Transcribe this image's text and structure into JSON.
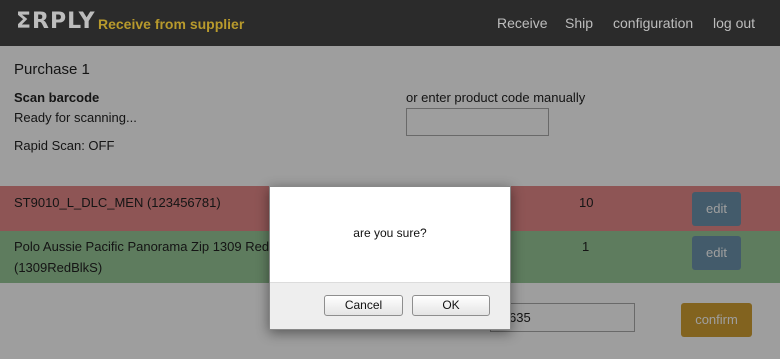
{
  "header": {
    "logo": "ΣRPLY",
    "subtitle": "Receive from supplier",
    "nav": [
      "Receive",
      "Ship",
      "configuration",
      "log out"
    ]
  },
  "main": {
    "purchase_title": "Purchase 1",
    "scan_label": "Scan barcode",
    "scan_status": "Ready for scanning...",
    "rapid_scan": "Rapid Scan: OFF",
    "manual_label": "or enter product code manually",
    "manual_input_value": ""
  },
  "rows": [
    {
      "name": "ST9010_L_DLC_MEN (123456781)",
      "qty_a": "10",
      "qty_b": "10",
      "edit_label": "edit",
      "status_color": "#e58a8a"
    },
    {
      "name": "Polo Aussie Pacific Panorama Zip 1309 RedBlk S",
      "code": "(1309RedBlkS)",
      "qty_a": "1",
      "qty_b": "1",
      "edit_label": "edit",
      "status_color": "#98c898"
    }
  ],
  "footer": {
    "input_value": "635",
    "confirm_label": "confirm"
  },
  "dialog": {
    "message": "are you sure?",
    "cancel_label": "Cancel",
    "ok_label": "OK"
  },
  "colors": {
    "header_bg": "#2b2b2b",
    "subtitle": "#b89a2c",
    "edit_button": "#6d94ad",
    "confirm_button": "#d2a033"
  }
}
